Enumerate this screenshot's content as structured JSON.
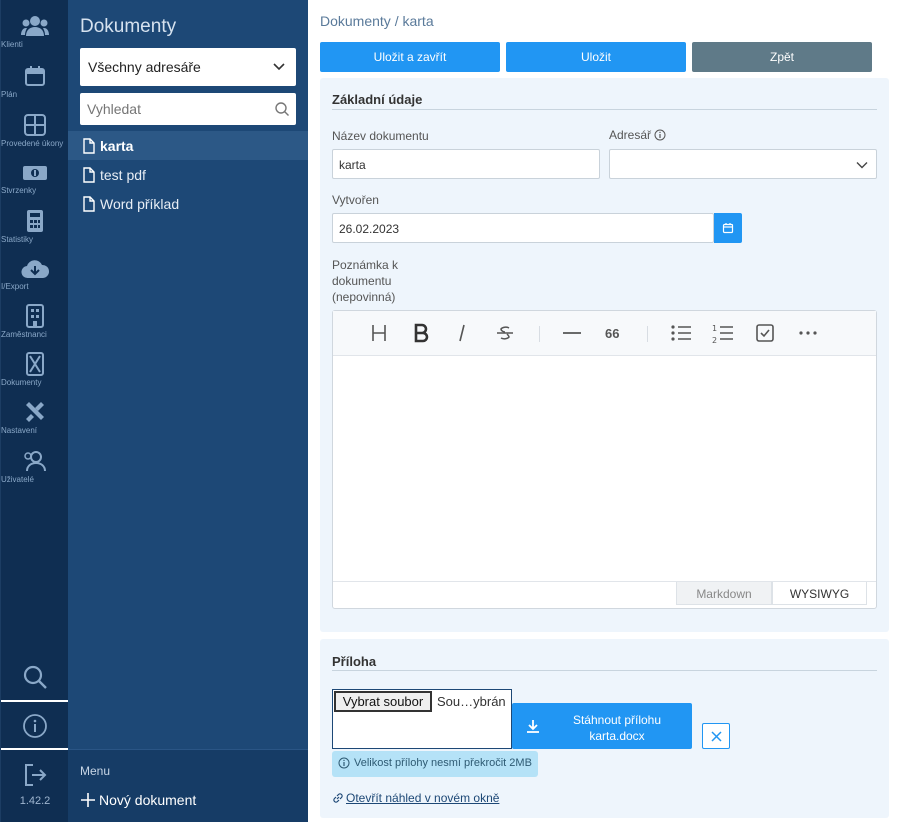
{
  "rail": {
    "items": [
      {
        "label": "Klienti",
        "icon": "users-icon"
      },
      {
        "label": "Plán",
        "icon": "calendar-icon"
      },
      {
        "label": "Provedené úkony",
        "icon": "grid-icon"
      },
      {
        "label": "Stvrzenky",
        "icon": "money-icon"
      },
      {
        "label": "Statistiky",
        "icon": "calculator-icon"
      },
      {
        "label": "I/Export",
        "icon": "cloud-download-icon"
      },
      {
        "label": "Zaměstnanci",
        "icon": "building-icon"
      },
      {
        "label": "Dokumenty",
        "icon": "hourglass-icon"
      },
      {
        "label": "Nastavení",
        "icon": "tools-icon"
      },
      {
        "label": "Uživatelé",
        "icon": "user-group-icon"
      }
    ],
    "version": "1.42.2"
  },
  "sidebar": {
    "title": "Dokumenty",
    "directory_select": "Všechny adresáře",
    "search_placeholder": "Vyhledat",
    "documents": [
      {
        "name": "karta",
        "active": true
      },
      {
        "name": "test pdf",
        "active": false
      },
      {
        "name": "Word příklad",
        "active": false
      }
    ],
    "menu_label": "Menu",
    "new_document": "Nový dokument"
  },
  "main": {
    "breadcrumb": "Dokumenty / karta",
    "buttons": {
      "save_close": "Uložit a zavřít",
      "save": "Uložit",
      "back": "Zpět"
    },
    "basic": {
      "title": "Základní údaje",
      "name_label": "Název dokumentu",
      "name_value": "karta",
      "folder_label": "Adresář",
      "folder_value": "",
      "created_label": "Vytvořen",
      "created_value": "26.02.2023",
      "note_label_1": "Poznámka k",
      "note_label_2": "dokumentu",
      "note_label_3": "(nepovinná)",
      "editor_modes": {
        "markdown": "Markdown",
        "wysiwyg": "WYSIWYG"
      },
      "quote_glyph": "66"
    },
    "attachment": {
      "title": "Příloha",
      "choose_file": "Vybrat soubor",
      "file_state": "Sou…ybrán",
      "download_line1": "Stáhnout přílohu",
      "download_line2": "karta.docx",
      "size_info": "Velikost přílohy nesmí překročit 2MB",
      "preview_link": "Otevřít náhled v novém okně"
    }
  },
  "colors": {
    "rail_bg": "#0f2e52",
    "sidebar_bg": "#1d4876",
    "primary": "#2196f3",
    "back_button": "#5f7a88"
  }
}
